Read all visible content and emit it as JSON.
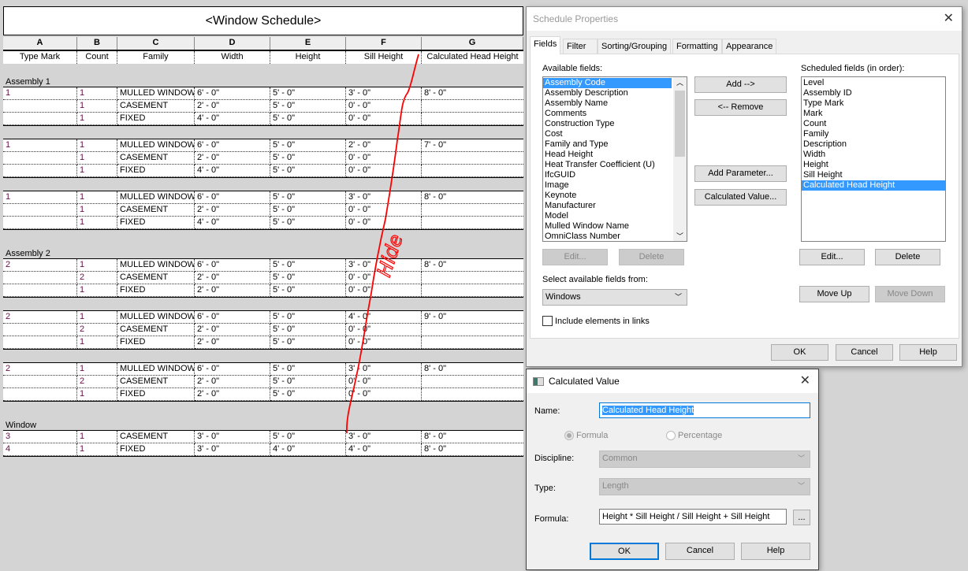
{
  "schedule": {
    "title": "<Window Schedule>",
    "column_letters": [
      "A",
      "B",
      "C",
      "D",
      "E",
      "F",
      "G"
    ],
    "column_headers": [
      "Type Mark",
      "Count",
      "Family",
      "Width",
      "Height",
      "Sill Height",
      "Calculated Head Height"
    ],
    "groups": [
      {
        "label": "Assembly 1",
        "blocks": [
          [
            [
              "1",
              "1",
              "MULLED WINDOW",
              "6' - 0\"",
              "5' - 0\"",
              "3' - 0\"",
              "8' - 0\""
            ],
            [
              "",
              "1",
              "CASEMENT",
              "2' - 0\"",
              "5' - 0\"",
              "0' - 0\"",
              ""
            ],
            [
              "",
              "1",
              "FIXED",
              "4' - 0\"",
              "5' - 0\"",
              "0' - 0\"",
              ""
            ]
          ],
          [
            [
              "1",
              "1",
              "MULLED WINDOW",
              "6' - 0\"",
              "5' - 0\"",
              "2' - 0\"",
              "7' - 0\""
            ],
            [
              "",
              "1",
              "CASEMENT",
              "2' - 0\"",
              "5' - 0\"",
              "0' - 0\"",
              ""
            ],
            [
              "",
              "1",
              "FIXED",
              "4' - 0\"",
              "5' - 0\"",
              "0' - 0\"",
              ""
            ]
          ],
          [
            [
              "1",
              "1",
              "MULLED WINDOW",
              "6' - 0\"",
              "5' - 0\"",
              "3' - 0\"",
              "8' - 0\""
            ],
            [
              "",
              "1",
              "CASEMENT",
              "2' - 0\"",
              "5' - 0\"",
              "0' - 0\"",
              ""
            ],
            [
              "",
              "1",
              "FIXED",
              "4' - 0\"",
              "5' - 0\"",
              "0' - 0\"",
              ""
            ]
          ]
        ]
      },
      {
        "label": "Assembly 2",
        "blocks": [
          [
            [
              "2",
              "1",
              "MULLED WINDOW",
              "6' - 0\"",
              "5' - 0\"",
              "3' - 0\"",
              "8' - 0\""
            ],
            [
              "",
              "2",
              "CASEMENT",
              "2' - 0\"",
              "5' - 0\"",
              "0' - 0\"",
              ""
            ],
            [
              "",
              "1",
              "FIXED",
              "2' - 0\"",
              "5' - 0\"",
              "0' - 0\"",
              ""
            ]
          ],
          [
            [
              "2",
              "1",
              "MULLED WINDOW",
              "6' - 0\"",
              "5' - 0\"",
              "4' - 0\"",
              "9' - 0\""
            ],
            [
              "",
              "2",
              "CASEMENT",
              "2' - 0\"",
              "5' - 0\"",
              "0' - 0\"",
              ""
            ],
            [
              "",
              "1",
              "FIXED",
              "2' - 0\"",
              "5' - 0\"",
              "0' - 0\"",
              ""
            ]
          ],
          [
            [
              "2",
              "1",
              "MULLED WINDOW",
              "6' - 0\"",
              "5' - 0\"",
              "3' - 0\"",
              "8' - 0\""
            ],
            [
              "",
              "2",
              "CASEMENT",
              "2' - 0\"",
              "5' - 0\"",
              "0' - 0\"",
              ""
            ],
            [
              "",
              "1",
              "FIXED",
              "2' - 0\"",
              "5' - 0\"",
              "0' - 0\"",
              ""
            ]
          ]
        ]
      },
      {
        "label": "Window",
        "blocks": [
          [
            [
              "3",
              "1",
              "CASEMENT",
              "3' - 0\"",
              "5' - 0\"",
              "3' - 0\"",
              "8' - 0\""
            ],
            [
              "4",
              "1",
              "FIXED",
              "3' - 0\"",
              "4' - 0\"",
              "4' - 0\"",
              "8' - 0\""
            ]
          ]
        ]
      }
    ],
    "annotation_text": "Hide",
    "annotation_color": "#ff0000"
  },
  "schedule_properties": {
    "title": "Schedule Properties",
    "tabs": [
      "Fields",
      "Filter",
      "Sorting/Grouping",
      "Formatting",
      "Appearance"
    ],
    "active_tab": "Fields",
    "available_label": "Available fields:",
    "available_fields": [
      "Assembly Code",
      "Assembly Description",
      "Assembly Name",
      "Comments",
      "Construction Type",
      "Cost",
      "Family and Type",
      "Head Height",
      "Heat Transfer Coefficient (U)",
      "IfcGUID",
      "Image",
      "Keynote",
      "Manufacturer",
      "Model",
      "Mulled Window Name",
      "OmniClass Number"
    ],
    "available_selected": "Assembly Code",
    "scheduled_label": "Scheduled fields (in order):",
    "scheduled_fields": [
      "Level",
      "Assembly ID",
      "Type Mark",
      "Mark",
      "Count",
      "Family",
      "Description",
      "Width",
      "Height",
      "Sill Height",
      "Calculated Head Height"
    ],
    "scheduled_selected": "Calculated Head Height",
    "add": "Add -->",
    "remove": "<-- Remove",
    "add_parameter": "Add Parameter...",
    "calculated_value": "Calculated Value...",
    "edit_left": "Edit...",
    "delete_left": "Delete",
    "edit_right": "Edit...",
    "delete_right": "Delete",
    "select_from_label": "Select available fields from:",
    "select_from_value": "Windows",
    "move_up": "Move Up",
    "move_down": "Move Down",
    "include_links": "Include elements in links",
    "include_links_checked": false,
    "ok": "OK",
    "cancel": "Cancel",
    "help": "Help"
  },
  "calculated_value": {
    "title": "Calculated Value",
    "name_label": "Name:",
    "name_value": "Calculated Head Height",
    "formula_radio": "Formula",
    "percentage_radio": "Percentage",
    "selected_mode": "Formula",
    "discipline_label": "Discipline:",
    "discipline_value": "Common",
    "type_label": "Type:",
    "type_value": "Length",
    "formula_label": "Formula:",
    "formula_value": "Height * Sill Height / Sill Height + Sill Height",
    "browse": "...",
    "ok": "OK",
    "cancel": "Cancel",
    "help": "Help",
    "selection_color": "#3399ff"
  }
}
